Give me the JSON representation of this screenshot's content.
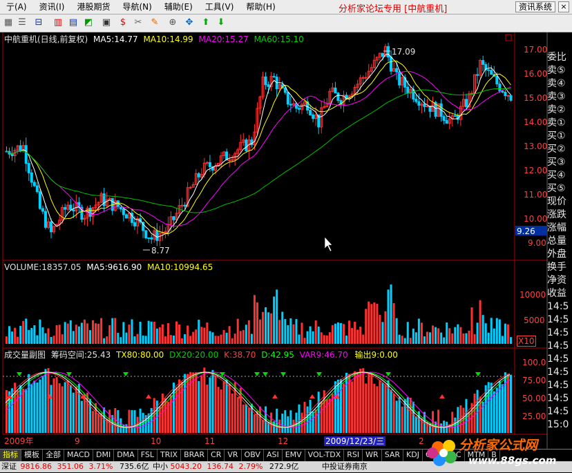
{
  "menu": {
    "items": [
      {
        "label": "亍(A)"
      },
      {
        "label": "资讯(I)"
      },
      {
        "label": "港股期货"
      },
      {
        "label": "导航(N)"
      },
      {
        "label": "辅助(E)"
      },
      {
        "label": "工具(V)"
      },
      {
        "label": "帮助(H)"
      }
    ],
    "brand": "分析家论坛专用 [中航重机]",
    "system_button": "资讯系统",
    "close_label": "×"
  },
  "chart": {
    "title": "中航重机(日线,前复权)",
    "ma5": "MA5:14.77",
    "ma10": "MA10:14.99",
    "ma20": "MA20:15.27",
    "ma60": "MA60:15.10",
    "high_label": "17.09",
    "low_label": "8.77",
    "current_price": "9.26",
    "price_ticks": [
      "17.00",
      "16.00",
      "15.00",
      "14.00",
      "13.00",
      "12.00",
      "11.00",
      "10.00",
      "9.00"
    ],
    "colors": {
      "up": "#ff3232",
      "down": "#00d0ff",
      "ma5": "#ffffff",
      "ma10": "#ffff00",
      "ma20": "#ff00ff",
      "ma60": "#00c000",
      "grid": "#b00000"
    }
  },
  "volume": {
    "label": "VOLUME:18357.05",
    "ma5": "MA5:9616.90",
    "ma10": "MA10:10994.65",
    "ticks": [
      "10000",
      "5000"
    ],
    "unit": "X10"
  },
  "indicator": {
    "label": "成交量副图",
    "chip": "筹码空间:25.43",
    "tx": "TX80:80.00",
    "dx": "DX20:20.00",
    "k": "K:38.70",
    "d": "D:42.95",
    "var9": "VAR9:46.70",
    "out": "输出9:0.00",
    "ticks": [
      "100.0",
      "75.00",
      "50.00",
      "25.00"
    ]
  },
  "time_axis": {
    "labels": [
      "2009年",
      "9",
      "10",
      "11",
      "12",
      "2009/12/23/三",
      "2"
    ]
  },
  "right_panel": {
    "rows": [
      "委比",
      "卖⑤",
      "卖④",
      "卖③",
      "卖②",
      "卖①",
      "买①",
      "买②",
      "买③",
      "买④",
      "买⑤",
      "现价",
      "涨跌",
      "涨幅",
      "总量",
      "外盘",
      "换手",
      "净资",
      "收益",
      "14:5",
      "14:5",
      "14:5",
      "14:5",
      "14:5",
      "14:5",
      "14:5",
      "14:5",
      "14:5",
      "15:0"
    ]
  },
  "bottom_tabs": [
    "指标",
    "模板",
    "全部",
    "MACD",
    "DMI",
    "DMA",
    "FSL",
    "TRIX",
    "BRAR",
    "CR",
    "VR",
    "OBV",
    "ASI",
    "EMV",
    "VOL-TDX",
    "RSI",
    "WR",
    "SAR",
    "KDJ",
    "CCI",
    "ROC",
    "MTM",
    "B"
  ],
  "status": {
    "index1_name": "深证",
    "index1": "9816.86",
    "index1_chg": "351.06",
    "index1_pct": "3.71%",
    "index1_amt": "735.6亿",
    "index2_name": "中小",
    "index2": "5043.20",
    "index2_chg": "136.74",
    "index2_pct": "2.79%",
    "index2_amt": "272.9亿",
    "broker": "中投证券南京"
  },
  "logo": {
    "text": "分析家公式网",
    "url_text": "www.88gs.com"
  }
}
